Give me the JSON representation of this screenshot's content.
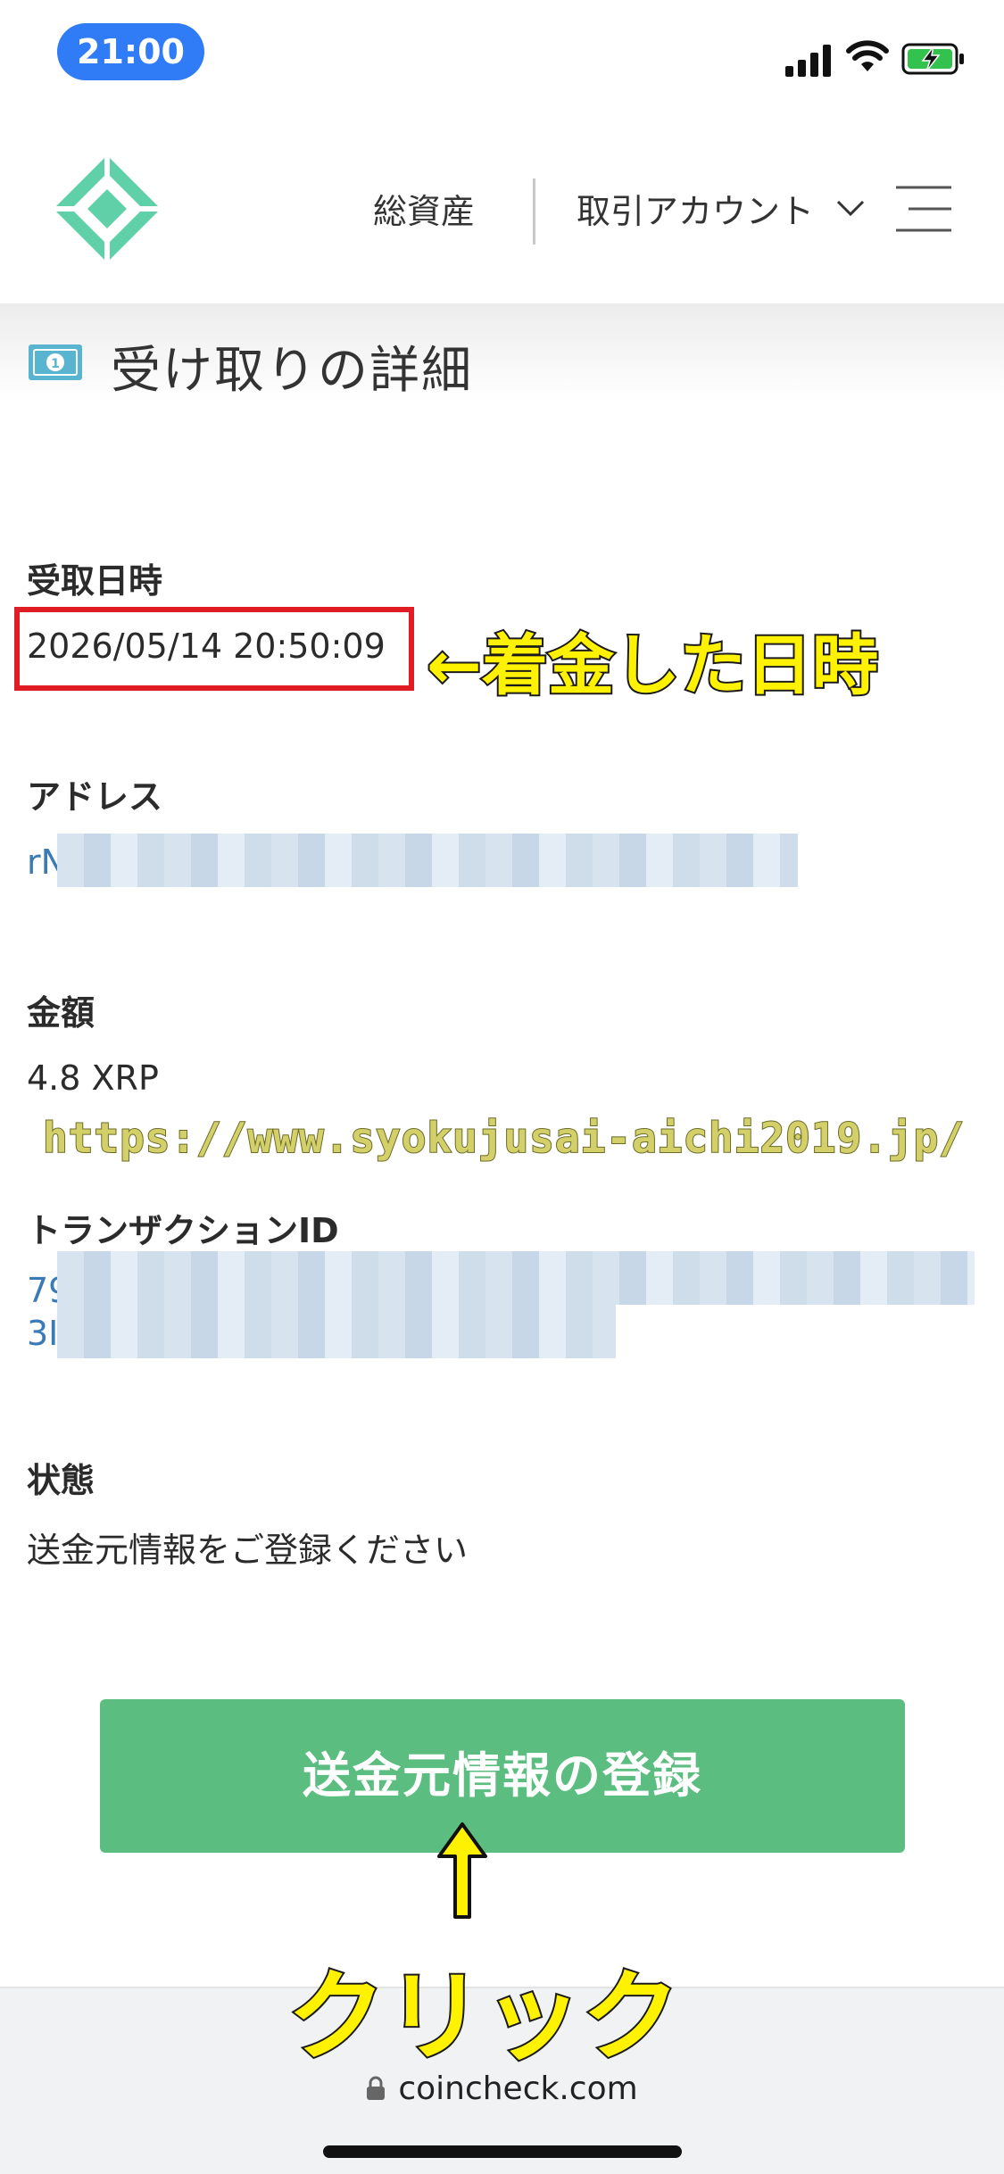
{
  "status_bar": {
    "time": "21:00"
  },
  "header": {
    "total_assets": "総資産",
    "account_menu": "取引アカウント"
  },
  "page": {
    "title": "受け取りの詳細"
  },
  "fields": {
    "received_at_label": "受取日時",
    "received_at_value": "2026/05/14 20:50:09",
    "address_label": "アドレス",
    "address_visible_prefix": "rN",
    "amount_label": "金額",
    "amount_value": "4.8 XRP",
    "txid_label": "トランザクションID",
    "txid_line1_prefix": "79",
    "txid_line2_prefix": "3I",
    "status_label": "状態",
    "status_value": "送金元情報をご登録ください"
  },
  "actions": {
    "register_button": "送金元情報の登録"
  },
  "annotations": {
    "date_note": "←着金した日時",
    "watermark_url": "https://www.syokujusai-aichi2019.jp/",
    "click_note": "クリック"
  },
  "browser": {
    "url": "coincheck.com"
  },
  "colors": {
    "brand_green": "#5bbd7f",
    "logo_green": "#5fd0a8",
    "link_blue": "#3a7ab6",
    "highlight_red": "#e01c24",
    "annotation_yellow": "#fff200",
    "status_blue": "#2f7cf6"
  }
}
